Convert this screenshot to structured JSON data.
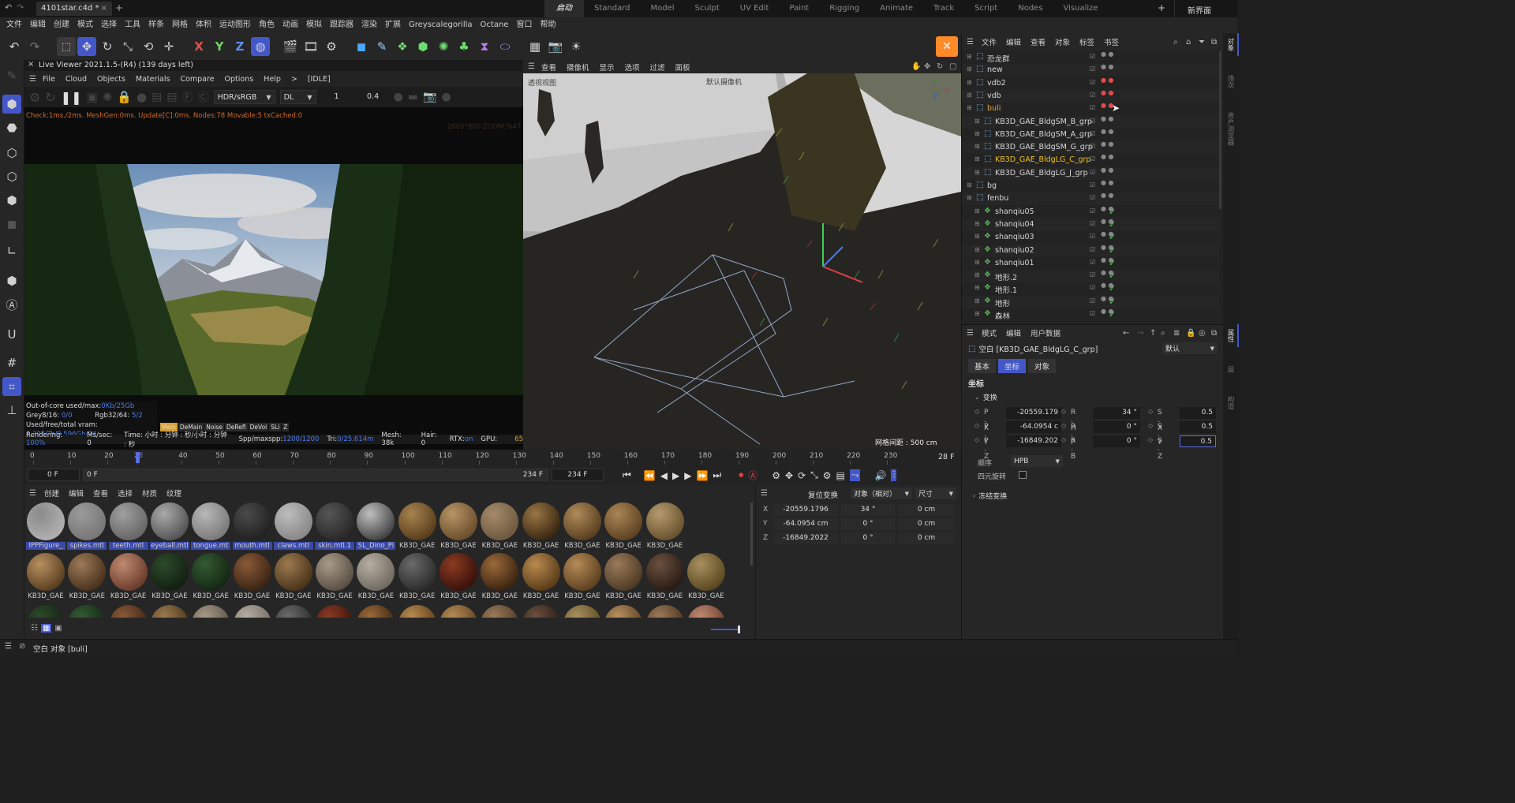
{
  "titlebar": {
    "file_tab": "4101star.c4d *",
    "add_tab": "+",
    "layouts": [
      "启动",
      "Standard",
      "Model",
      "Sculpt",
      "UV Edit",
      "Paint",
      "Rigging",
      "Animate",
      "Track",
      "Script",
      "Nodes",
      "Visualize"
    ],
    "active_layout": "启动",
    "add_layout": "+",
    "new_ui": "新界面"
  },
  "menubar": [
    "文件",
    "编辑",
    "创建",
    "模式",
    "选择",
    "工具",
    "样条",
    "网格",
    "体积",
    "运动图形",
    "角色",
    "动画",
    "模拟",
    "跟踪器",
    "渲染",
    "扩展",
    "Greyscalegorilla",
    "Octane",
    "窗口",
    "帮助"
  ],
  "liveviewer": {
    "title": "Live Viewer 2021.1.5-(R4) (139 days left)",
    "menu": [
      "File",
      "Cloud",
      "Objects",
      "Materials",
      "Compare",
      "Options",
      "Help",
      ">",
      "[IDLE]"
    ],
    "kernel": "HDR/sRGB",
    "mode": "DL",
    "val1": "1",
    "val2": "0.4",
    "check_line": "Check:1ms./2ms. MeshGen:0ms. Update[C]:0ms. Nodes:78 Movable:5 txCached:0",
    "res_line": "2000*800 ZOOM:%47",
    "stats": {
      "ooc": "Out-of-core used/max:",
      "ooc_val": "0Kb/25Gb",
      "grey": "Grey8/16: ",
      "grey_val": "0/0",
      "rgb": "Rgb32/64: ",
      "rgb_val": "5/2",
      "vram": "Used/free/total vram: ",
      "vram_val": "6.395Gb/9.596Gb/24",
      "passes": [
        "Main",
        "DeMain",
        "Noise",
        "DeRefl",
        "DeVol",
        "SLi",
        "Z"
      ],
      "rendering": "Rendering:",
      "rendering_val": "100%",
      "ms": "Ms/sec: 0",
      "time": "Time: 小时 : 分钟 : 秒/小时 : 分钟 : 秒",
      "spp": "Spp/maxspp:",
      "spp_val": "1200/1200",
      "tri": "Tri:",
      "tri_val": "0/25.614m",
      "mesh": "Mesh: 38k",
      "hair": "Hair: 0",
      "rtx": "RTX:",
      "rtx_val": "on",
      "gpu": "GPU:",
      "gpu_val": "65"
    }
  },
  "viewport": {
    "menu": [
      "查看",
      "摄像机",
      "显示",
      "选项",
      "过滤",
      "面板"
    ],
    "label_left": "透视视图",
    "label_cam": "默认摄像机",
    "grid_info": "网格间距 : 500 cm",
    "axis_y": "Y",
    "axis_x": "X",
    "axis_z": "Z"
  },
  "timeline": {
    "ticks": [
      "0",
      "10",
      "20",
      "28",
      "40",
      "50",
      "60",
      "70",
      "80",
      "90",
      "100",
      "110",
      "120",
      "130",
      "140",
      "150",
      "160",
      "170",
      "180",
      "190",
      "200",
      "210",
      "220",
      "230"
    ],
    "current_frame": "28 F",
    "start": "0 F",
    "start2": "0 F",
    "end": "234 F",
    "end2": "234 F"
  },
  "materials": {
    "menu": [
      "创建",
      "编辑",
      "查看",
      "选择",
      "材质",
      "纹理"
    ],
    "row1": [
      "IPPFigure_",
      "spikes.mtl",
      "teeth.mtl",
      "eyeball.mtl",
      "tongue.mt",
      "mouth.mtl",
      "claws.mtl",
      "skin.mtl.1",
      "SL_Dino_Pi",
      "KB3D_GAE",
      "KB3D_GAE",
      "KB3D_GAE",
      "KB3D_GAE",
      "KB3D_GAE",
      "KB3D_GAE",
      "KB3D_GAE"
    ],
    "row2": [
      "KB3D_GAE",
      "KB3D_GAE",
      "KB3D_GAE",
      "KB3D_GAE",
      "KB3D_GAE",
      "KB3D_GAE",
      "KB3D_GAE",
      "KB3D_GAE",
      "KB3D_GAE",
      "KB3D_GAE",
      "KB3D_GAE",
      "KB3D_GAE",
      "KB3D_GAE",
      "KB3D_GAE",
      "KB3D_GAE",
      "KB3D_GAE",
      "KB3D_GAE"
    ]
  },
  "coords": {
    "reset": "复位变换",
    "mode": "对象（相对）",
    "size": "尺寸",
    "rows": [
      {
        "axis": "X",
        "pos": "-20559.1796",
        "rot": "34 °",
        "size": "0 cm"
      },
      {
        "axis": "Y",
        "pos": "-64.0954 cm",
        "rot": "0 °",
        "size": "0 cm"
      },
      {
        "axis": "Z",
        "pos": "-16849.2022",
        "rot": "0 °",
        "size": "0 cm"
      }
    ]
  },
  "objects": {
    "menu": [
      "文件",
      "编辑",
      "查看",
      "对象",
      "标签",
      "书签"
    ],
    "items": [
      {
        "name": "恐龙群",
        "indent": 0,
        "tag": "dot"
      },
      {
        "name": "new",
        "indent": 0,
        "tag": "dot"
      },
      {
        "name": "vdb2",
        "indent": 0,
        "tag": "red"
      },
      {
        "name": "vdb",
        "indent": 0,
        "tag": "red"
      },
      {
        "name": "buli",
        "indent": 0,
        "tag": "red",
        "color": "#e8a33c"
      },
      {
        "name": "KB3D_GAE_BldgSM_B_grp",
        "indent": 1,
        "tag": "dot"
      },
      {
        "name": "KB3D_GAE_BldgSM_A_grp",
        "indent": 1,
        "tag": "dot"
      },
      {
        "name": "KB3D_GAE_BldgSM_G_grp",
        "indent": 1,
        "tag": "dot"
      },
      {
        "name": "KB3D_GAE_BldgLG_C_grp",
        "indent": 1,
        "tag": "dot",
        "color": "#f0c020"
      },
      {
        "name": "KB3D_GAE_BldgLG_J_grp",
        "indent": 1,
        "tag": "dot"
      },
      {
        "name": "bg",
        "indent": 0,
        "tag": "dot"
      },
      {
        "name": "fenbu",
        "indent": 0,
        "tag": "dot"
      },
      {
        "name": "shanqiu05",
        "indent": 1,
        "tag": "check"
      },
      {
        "name": "shanqiu04",
        "indent": 1,
        "tag": "check"
      },
      {
        "name": "shanqiu03",
        "indent": 1,
        "tag": "check"
      },
      {
        "name": "shanqiu02",
        "indent": 1,
        "tag": "check"
      },
      {
        "name": "shanqiu01",
        "indent": 1,
        "tag": "check"
      },
      {
        "name": "地形.2",
        "indent": 1,
        "tag": "check"
      },
      {
        "name": "地形.1",
        "indent": 1,
        "tag": "check"
      },
      {
        "name": "地形",
        "indent": 1,
        "tag": "check"
      },
      {
        "name": "森林",
        "indent": 1,
        "tag": "check"
      }
    ]
  },
  "attributes": {
    "menu": [
      "模式",
      "编辑",
      "用户数据"
    ],
    "title": "空白 [KB3D_GAE_BldgLG_C_grp]",
    "preset": "默认",
    "tabs": [
      "基本",
      "坐标",
      "对象"
    ],
    "active_tab": "坐标",
    "section": "坐标",
    "group": "变换",
    "fields": [
      {
        "l1": "P . X",
        "v1": "-20559.179",
        "l2": "R . H",
        "v2": "34 °",
        "l3": "S . X",
        "v3": "0.5"
      },
      {
        "l1": "P . Y",
        "v1": "-64.0954 c",
        "l2": "R . P",
        "v2": "0 °",
        "l3": "S . Y",
        "v3": "0.5"
      },
      {
        "l1": "P . Z",
        "v1": "-16849.202",
        "l2": "R . B",
        "v2": "0 °",
        "l3": "S . Z",
        "v3": "0.5"
      }
    ],
    "order_label": "顺序",
    "order_value": "HPB",
    "quat_label": "四元旋转",
    "frozen": "冻结变换"
  },
  "rightstrip": [
    "对象",
    "场次",
    "资产浏览器",
    "属性",
    "层",
    "构造"
  ],
  "status": {
    "text": "空白 对象 [buli]"
  },
  "colors": {
    "accent": "#5a6ee0",
    "active_tab": "#4457c9",
    "orange_close": "#ff8a2a",
    "selected_obj": "#f0c020",
    "check": "#4fd05a"
  }
}
